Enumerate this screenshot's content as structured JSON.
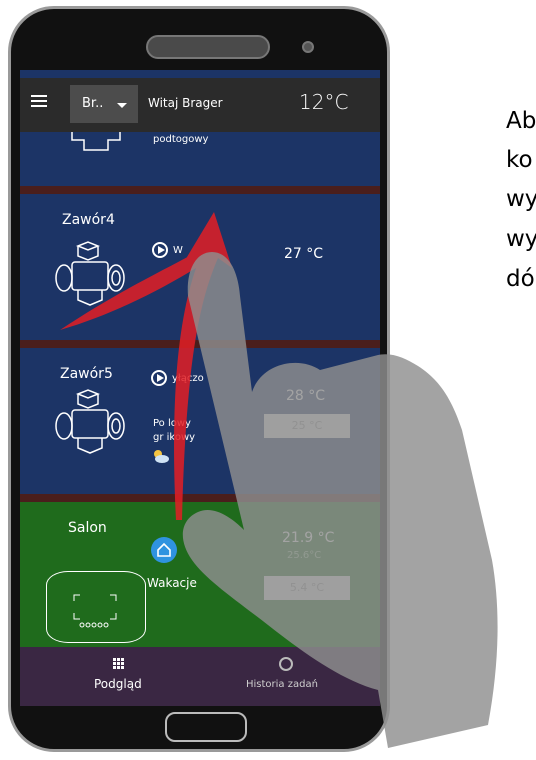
{
  "header": {
    "dropdown_label": "Br..",
    "greeting": "Witaj Brager",
    "temperature": "12°C"
  },
  "cards": [
    {
      "name": "",
      "subtitle": "podtogowy"
    },
    {
      "name": "Zawór4",
      "status": "W",
      "status2": "",
      "temperature": "27 °C"
    },
    {
      "name": "Zawór5",
      "status": "yłączo",
      "mode_line1": "Po lowy",
      "mode_line2": "gr ikowy",
      "temperature": "28 °C",
      "setpoint": "25 °C"
    },
    {
      "name": "Salon",
      "mode_label": "Wakacje",
      "temperature": "21.9 °C",
      "temp_secondary": "25.6°C",
      "setpoint": "5.4 °C"
    }
  ],
  "bottom_nav": [
    {
      "label": "Podgląd",
      "icon": "grid-icon"
    },
    {
      "label": "Historia zadań",
      "icon": "clock-icon"
    }
  ],
  "instruction_text": [
    "Ab",
    "ko",
    "wy",
    "wy",
    "dó"
  ],
  "colors": {
    "card_blue": "#1c3466",
    "card_green": "#1f6b1c",
    "separator": "#4a1e1c",
    "app_bar": "#2b2b2b",
    "bottom_nav": "#3a2743",
    "arrow": "#e31e24",
    "hand": "#999999"
  }
}
